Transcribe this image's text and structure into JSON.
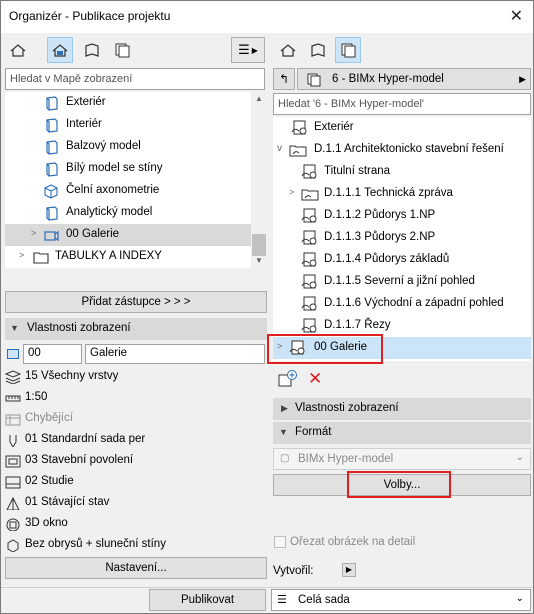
{
  "window": {
    "title": "Organizér - Publikace projektu",
    "close": "✕"
  },
  "left": {
    "search_placeholder": "Hledat v Mapě zobrazení",
    "tree": [
      {
        "label": "Exteriér",
        "icon": "box-3d-icon"
      },
      {
        "label": "Interiér",
        "icon": "box-3d-icon"
      },
      {
        "label": "Balzový model",
        "icon": "box-3d-icon"
      },
      {
        "label": "Bílý model se stíny",
        "icon": "box-3d-icon"
      },
      {
        "label": "Čelní axonometrie",
        "icon": "cube-axon-icon"
      },
      {
        "label": "Analytický model",
        "icon": "box-3d-icon"
      },
      {
        "label": "00 Galerie",
        "icon": "camera-icon"
      },
      {
        "label": "TABULKY A INDEXY",
        "icon": "folder-icon"
      }
    ],
    "add_button": "Přidat zástupce > > >",
    "props_header": "Vlastnosti zobrazení",
    "view_id": "00",
    "view_name": "Galerie",
    "props": [
      {
        "label": "15 Všechny vrstvy",
        "icon": "layers-icon"
      },
      {
        "label": "1:50",
        "icon": "scale-icon"
      },
      {
        "label": "Chybějící",
        "icon": "structure-icon",
        "disabled": true
      },
      {
        "label": "01 Standardní sada per",
        "icon": "pen-icon"
      },
      {
        "label": "03 Stavební povolení",
        "icon": "model-view-icon"
      },
      {
        "label": "02 Studie",
        "icon": "graphic-override-icon"
      },
      {
        "label": "01 Stávající stav",
        "icon": "renovation-icon"
      },
      {
        "label": "3D okno",
        "icon": "window-3d-icon"
      },
      {
        "label": "Bez obrysů + sluneční stíny",
        "icon": "style-3d-icon"
      }
    ],
    "settings_button": "Nastavení..."
  },
  "right": {
    "set_name": "6 - BIMx Hyper-model",
    "search_placeholder": "Hledat '6 - BIMx Hyper-model'",
    "tree": [
      {
        "label": "Exteriér",
        "icon": "publish-item-icon"
      },
      {
        "label": "D.1.1 Architektonicko stavební řešení",
        "icon": "publish-folder-icon"
      },
      {
        "label": "Titulní strana",
        "icon": "publish-item-icon"
      },
      {
        "label": "D.1.1.1 Technická zpráva",
        "icon": "publish-folder-icon"
      },
      {
        "label": "D.1.1.2 Půdorys 1.NP",
        "icon": "publish-item-icon"
      },
      {
        "label": "D.1.1.3 Půdorys 2.NP",
        "icon": "publish-item-icon"
      },
      {
        "label": "D.1.1.4 Půdorys základů",
        "icon": "publish-item-icon"
      },
      {
        "label": "D.1.1.5 Severní a jižní pohled",
        "icon": "publish-item-icon"
      },
      {
        "label": "D.1.1.6 Východní a západní pohled",
        "icon": "publish-item-icon"
      },
      {
        "label": "D.1.1.7 Řezy",
        "icon": "publish-item-icon"
      },
      {
        "label": "00 Galerie",
        "icon": "publish-item-icon"
      }
    ],
    "props_header": "Vlastnosti zobrazení",
    "format_header": "Formát",
    "format_value": "BIMx Hyper-model",
    "options_button": "Volby...",
    "crop_label": "Ořezat obrázek na detail",
    "create_label": "Vytvořil:"
  },
  "bottom": {
    "publish_button": "Publikovat",
    "set_select": "Celá sada"
  },
  "colors": {
    "highlight": "#e02020",
    "selection": "#cce4f7",
    "icon": "#2a6db5"
  }
}
